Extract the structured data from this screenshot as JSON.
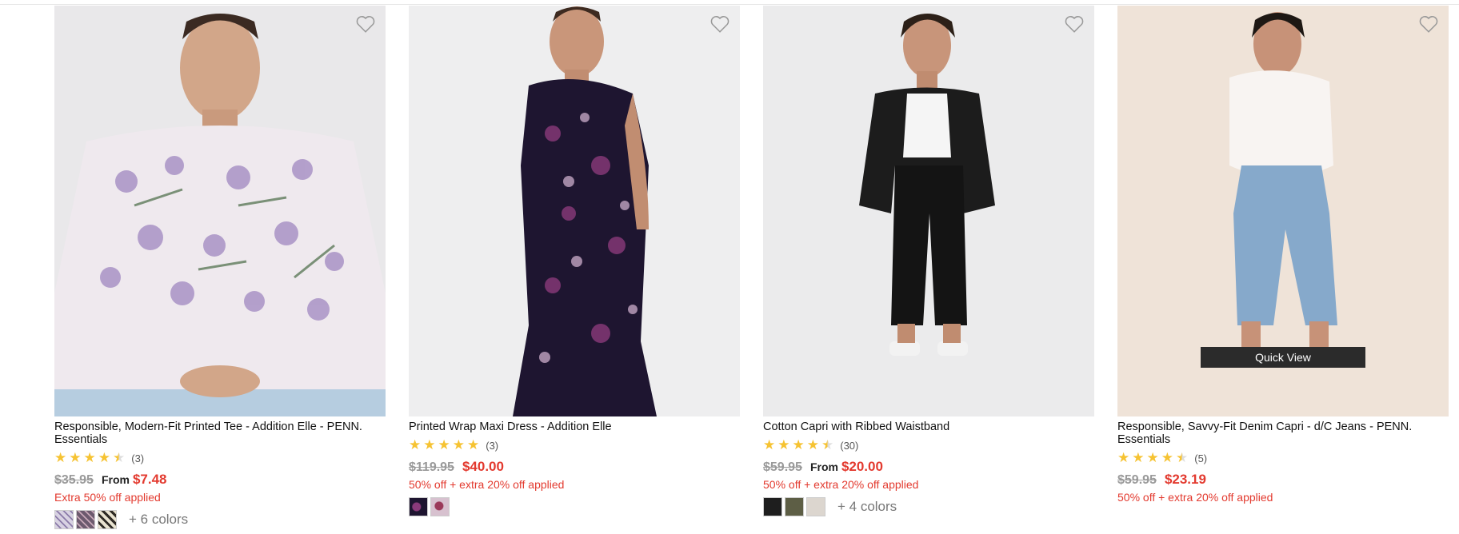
{
  "products": [
    {
      "title": "Responsible, Modern-Fit Printed Tee - Addition Elle - PENN. Essentials",
      "rating_count": "(3)",
      "stars": 4.5,
      "old_price": "$35.95",
      "from_label": "From",
      "price": "$7.48",
      "promo": "Extra 50% off applied",
      "more_colors": "+ 6 colors",
      "swatch_colors": [
        "#d8d2e2",
        "#6c5a6e",
        "#e9e3d0"
      ]
    },
    {
      "title": "Printed Wrap Maxi Dress - Addition Elle",
      "rating_count": "(3)",
      "stars": 5,
      "old_price": "$119.95",
      "from_label": "",
      "price": "$40.00",
      "promo": "50% off + extra 20% off applied",
      "more_colors": "",
      "swatch_colors": [
        "#2a1a3a",
        "#d7c1cf"
      ]
    },
    {
      "title": "Cotton Capri with Ribbed Waistband",
      "rating_count": "(30)",
      "stars": 4.5,
      "old_price": "$59.95",
      "from_label": "From",
      "price": "$20.00",
      "promo": "50% off + extra 20% off applied",
      "more_colors": "+ 4 colors",
      "swatch_colors": [
        "#1e1e1e",
        "#5d5e45",
        "#dcd6cf"
      ]
    },
    {
      "title": "Responsible, Savvy-Fit Denim Capri - d/C Jeans - PENN. Essentials",
      "rating_count": "(5)",
      "stars": 4.5,
      "old_price": "$59.95",
      "from_label": "",
      "price": "$23.19",
      "promo": "50% off + extra 20% off applied",
      "more_colors": "",
      "swatch_colors": []
    }
  ],
  "quick_view_label": "Quick View",
  "colors": {
    "sale": "#e33a2f",
    "star": "#f6c332",
    "old_price": "#9a9a9a"
  }
}
